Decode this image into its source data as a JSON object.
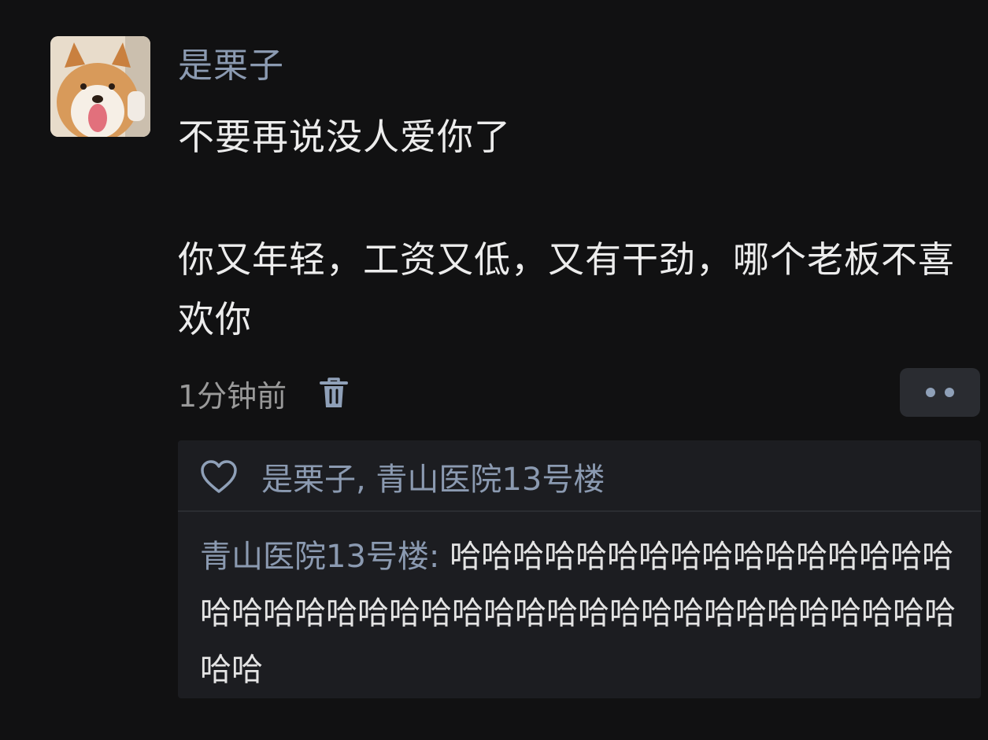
{
  "post": {
    "username": "是栗子",
    "line1": "不要再说没人爱你了",
    "line2": "你又年轻，工资又低，又有干劲，哪个老板不喜欢你",
    "timestamp": "1分钟前",
    "avatar_icon": "shiba-dog-avatar",
    "delete_icon": "trash-icon",
    "more_icon": "more-dots-icon"
  },
  "likes": {
    "icon": "heart-icon",
    "text": "是栗子, 青山医院13号楼"
  },
  "comment": {
    "author": "青山医院13号楼",
    "separator": ": ",
    "text": "哈哈哈哈哈哈哈哈哈哈哈哈哈哈哈哈哈哈哈哈哈哈哈哈哈哈哈哈哈哈哈哈哈哈哈哈哈哈哈哈哈哈"
  },
  "colors": {
    "background": "#111112",
    "name_accent": "#8b9ab1",
    "panel": "#1c1d21",
    "text": "#ececec"
  }
}
